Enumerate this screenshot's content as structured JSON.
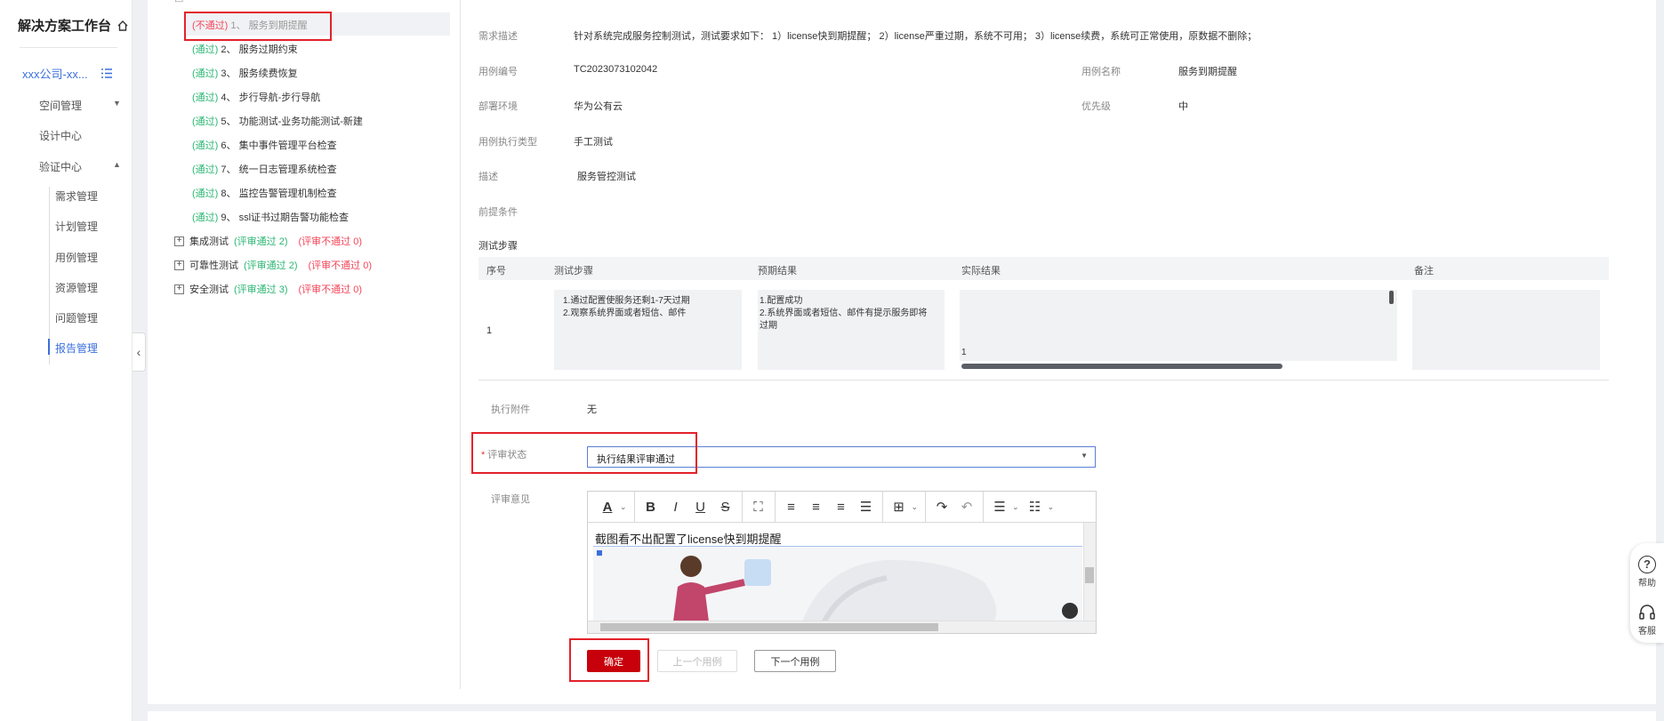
{
  "sidebar": {
    "title": "解决方案工作台",
    "company": "xxx公司-xx...",
    "menu": [
      {
        "label": "空间管理"
      },
      {
        "label": "设计中心"
      },
      {
        "label": "验证中心"
      }
    ],
    "submenu": [
      {
        "label": "需求管理"
      },
      {
        "label": "计划管理"
      },
      {
        "label": "用例管理"
      },
      {
        "label": "资源管理"
      },
      {
        "label": "问题管理"
      },
      {
        "label": "报告管理",
        "active": true
      }
    ]
  },
  "tree": {
    "cases": [
      {
        "status": "(不通过)",
        "name": "1、 服务到期提醒",
        "result": "fail",
        "selected": true
      },
      {
        "status": "(通过)",
        "name": "2、 服务过期约束",
        "result": "pass"
      },
      {
        "status": "(通过)",
        "name": "3、 服务续费恢复",
        "result": "pass"
      },
      {
        "status": "(通过)",
        "name": "4、 步行导航-步行导航",
        "result": "pass"
      },
      {
        "status": "(通过)",
        "name": "5、 功能测试-业务功能测试-新建",
        "result": "pass"
      },
      {
        "status": "(通过)",
        "name": "6、 集中事件管理平台检查",
        "result": "pass"
      },
      {
        "status": "(通过)",
        "name": "7、 统一日志管理系统检查",
        "result": "pass"
      },
      {
        "status": "(通过)",
        "name": "8、 监控告警管理机制检查",
        "result": "pass"
      },
      {
        "status": "(通过)",
        "name": "9、 ssl证书过期告警功能检查",
        "result": "pass"
      }
    ],
    "groups": [
      {
        "name": "集成测试",
        "passed": "(评审通过 2)",
        "failed": "(评审不通过 0)"
      },
      {
        "name": "可靠性测试",
        "passed": "(评审通过 2)",
        "failed": "(评审不通过 0)"
      },
      {
        "name": "安全测试",
        "passed": "(评审通过 3)",
        "failed": "(评审不通过 0)"
      }
    ]
  },
  "detail": {
    "req_desc_label": "需求描述",
    "req_desc_value": "针对系统完成服务控制测试，测试要求如下： 1）license快到期提醒； 2）license严重过期，系统不可用； 3）license续费，系统可正常使用，原数据不删除；",
    "case_no_label": "用例编号",
    "case_no_value": "TC2023073102042",
    "case_name_label": "用例名称",
    "case_name_value": "服务到期提醒",
    "env_label": "部署环境",
    "env_value": "华为公有云",
    "priority_label": "优先级",
    "priority_value": "中",
    "exec_type_label": "用例执行类型",
    "exec_type_value": "手工测试",
    "desc_label": "描述",
    "desc_value": "服务管控测试",
    "precond_label": "前提条件",
    "steps_label": "测试步骤"
  },
  "steps_table": {
    "headers": [
      "序号",
      "测试步骤",
      "预期结果",
      "实际结果",
      "备注"
    ],
    "rows": [
      {
        "no": "1",
        "steps": [
          "1.通过配置使服务还剩1-7天过期",
          "2.观察系统界面或者短信、邮件"
        ],
        "expected": [
          "1.配置成功",
          "2.系统界面或者短信、邮件有提示服务即将过期"
        ],
        "actual": "1",
        "note": ""
      }
    ]
  },
  "review": {
    "attachment_label": "执行附件",
    "attachment_value": "无",
    "status_label": "评审状态",
    "status_value": "执行结果评审通过",
    "comment_label": "评审意见",
    "comment_text": "截图看不出配置了license快到期提醒"
  },
  "buttons": {
    "confirm": "确定",
    "prev": "上一个用例",
    "next": "下一个用例"
  },
  "help_widget": {
    "help_label": "帮助",
    "service_label": "客服"
  },
  "colors": {
    "primary": "#c7000b",
    "link": "#3b6fdc",
    "pass": "#2bb673",
    "fail": "#f5465a",
    "highlight_box": "#e3222a"
  }
}
